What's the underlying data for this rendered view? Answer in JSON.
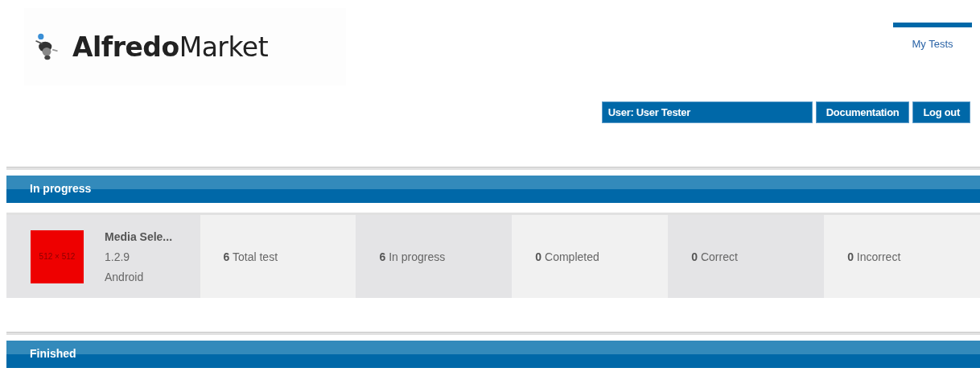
{
  "logo": {
    "text": "**Alfredo**Market"
  },
  "nav": [
    {
      "label": "My Tests",
      "selected": true
    }
  ],
  "user_bar": {
    "user": "User: User Tester",
    "buttons": [
      "Documentation",
      "Log out"
    ]
  },
  "sections": [
    {
      "title": "In progress",
      "apps": [
        {
          "icon_text": "512 × 512",
          "name": "Media Sele...",
          "version": "1.2.9",
          "platform": "Android",
          "stats": [
            {
              "value": "6",
              "label": "Total test"
            },
            {
              "value": "6",
              "label": "In progress"
            },
            {
              "value": "0",
              "label": "Completed"
            },
            {
              "value": "0",
              "label": "Correct"
            },
            {
              "value": "0",
              "label": "Incorrect"
            }
          ]
        }
      ]
    },
    {
      "title": "Finished"
    }
  ]
}
